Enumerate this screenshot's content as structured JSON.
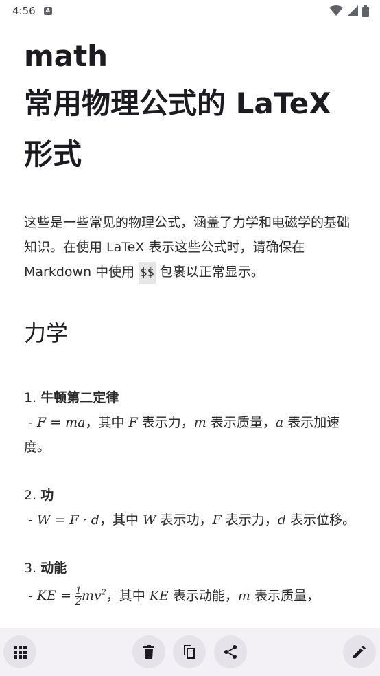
{
  "status": {
    "time": "4:56",
    "badge": "A"
  },
  "doc": {
    "title_math": "math",
    "title_main": "常用物理公式的 LaTeX 形式",
    "intro_before": "这些是一些常见的物理公式，涵盖了力学和电磁学的基础知识。在使用 LaTeX 表示这些公式时，请确保在 Markdown 中使用 ",
    "intro_code": "$$",
    "intro_after": " 包裹以正常显示。",
    "section_mechanics": "力学",
    "items": [
      {
        "num": "1.",
        "name": "牛顿第二定律",
        "formula": "F = ma",
        "t1": "，其中 ",
        "v1": "F",
        "d1": " 表示力，",
        "v2": "m",
        "d2": " 表示质量，",
        "v3": "a",
        "d3": " 表示加速度。"
      },
      {
        "num": "2.",
        "name": "功",
        "formula": "W = F · d",
        "t1": "，其中 ",
        "v1": "W",
        "d1": " 表示功，",
        "v2": "F",
        "d2": " 表示力，",
        "v3": "d",
        "d3": " 表示位移。"
      },
      {
        "num": "3.",
        "name": "动能",
        "formula_lhs": "KE = ",
        "formula_num": "1",
        "formula_den": "2",
        "formula_rhs": "mv",
        "formula_exp": "2",
        "t1": "，其中 ",
        "v1": "KE",
        "d1": " 表示动能，",
        "v2": "m",
        "d2": " 表示质量，"
      }
    ]
  },
  "icons": {
    "menu": "grid-icon",
    "delete": "trash-icon",
    "copy": "copy-icon",
    "share": "share-icon",
    "edit": "pencil-icon"
  }
}
